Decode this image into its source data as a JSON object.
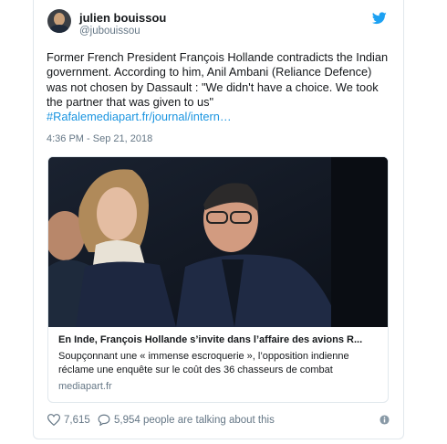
{
  "author": {
    "name": "julien bouissou",
    "handle": "@jubouissou",
    "avatar_icon": "person-photo"
  },
  "tweet": {
    "text": "Former French President François Hollande contradicts the Indian government. According to him, Anil Ambani (Reliance Defence) was not chosen by Dassault : \"We didn't have a choice. We took the partner that was given to us\"",
    "hashtag": "#Rafale",
    "link": "mediapart.fr/journal/intern…",
    "timestamp": "4:36 PM - Sep 21, 2018"
  },
  "card": {
    "image_icon": "news-photo",
    "title": "En Inde, François Hollande s’invite dans l’affaire des avions R...",
    "description": "Soupçonnant une « immense escroquerie », l’opposition indienne réclame une enquête sur le coût des 36 chasseurs de combat",
    "domain": "mediapart.fr"
  },
  "actions": {
    "likes": "7,615",
    "talking": "5,954 people are talking about this"
  },
  "colors": {
    "brand": "#1da1f2",
    "link": "#1b95e0",
    "muted": "#657786",
    "border": "#e1e8ed"
  }
}
